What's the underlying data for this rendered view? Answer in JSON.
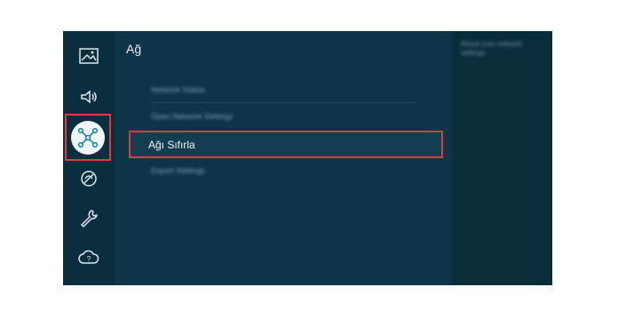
{
  "settings": {
    "section_title": "Ağ",
    "focused_item_label": "Ağı Sıfırla",
    "blurred_items": [
      "Network Status",
      "Open Network Settings",
      "Expert Settings"
    ],
    "side_panel_text": "Reset your network settings"
  },
  "rail": {
    "icons": [
      "picture-icon",
      "sound-icon",
      "network-icon",
      "support-icon",
      "tools-icon",
      "help-icon"
    ]
  },
  "colors": {
    "highlight_border": "#e03a3a",
    "background": "#0d3446"
  }
}
